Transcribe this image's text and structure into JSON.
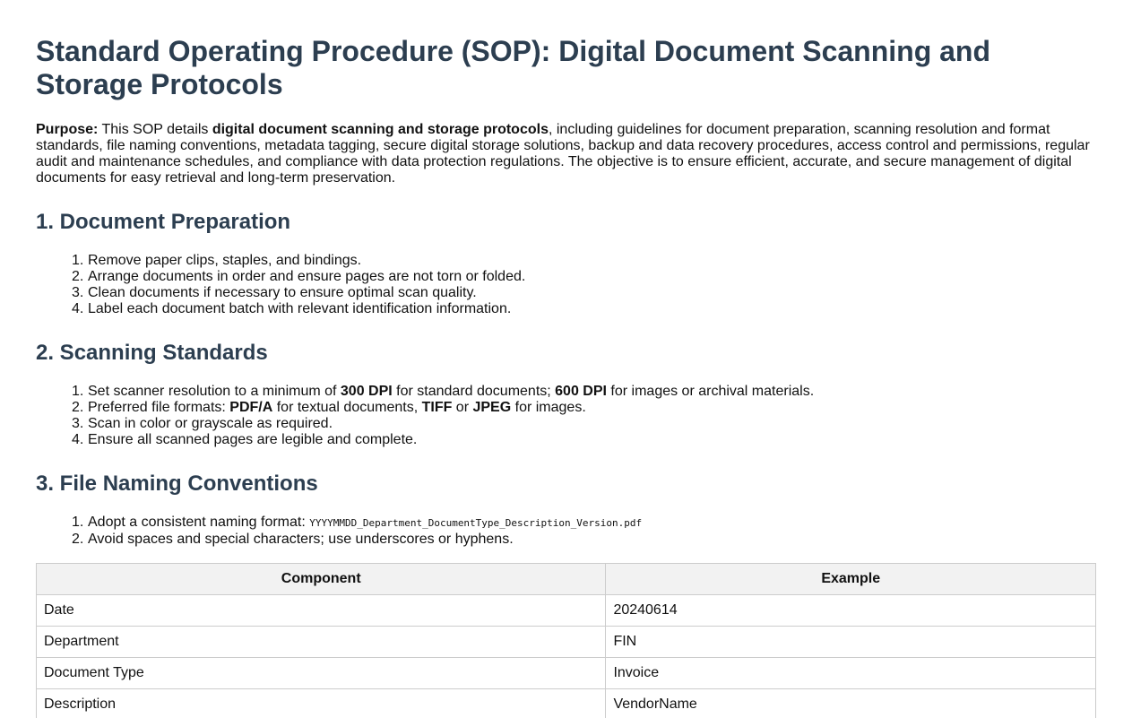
{
  "title": "Standard Operating Procedure (SOP): Digital Document Scanning and Storage Protocols",
  "purpose": {
    "label": "Purpose:",
    "pre": " This SOP details ",
    "bold": "digital document scanning and storage protocols",
    "post": ", including guidelines for document preparation, scanning resolution and format standards, file naming conventions, metadata tagging, secure digital storage solutions, backup and data recovery procedures, access control and permissions, regular audit and maintenance schedules, and compliance with data protection regulations. The objective is to ensure efficient, accurate, and secure management of digital documents for easy retrieval and long-term preservation."
  },
  "sections": [
    {
      "heading": "1. Document Preparation",
      "items": [
        "Remove paper clips, staples, and bindings.",
        "Arrange documents in order and ensure pages are not torn or folded.",
        "Clean documents if necessary to ensure optimal scan quality.",
        "Label each document batch with relevant identification information."
      ]
    },
    {
      "heading": "2. Scanning Standards",
      "items": [
        {
          "t1": "Set scanner resolution to a minimum of ",
          "b1": "300 DPI",
          "t2": " for standard documents; ",
          "b2": "600 DPI",
          "t3": " for images or archival materials."
        },
        {
          "t1": "Preferred file formats: ",
          "b1": "PDF/A",
          "t2": " for textual documents, ",
          "b2": "TIFF",
          "t3": " or ",
          "b3": "JPEG",
          "t4": " for images."
        },
        "Scan in color or grayscale as required.",
        "Ensure all scanned pages are legible and complete."
      ]
    },
    {
      "heading": "3. File Naming Conventions",
      "items": [
        {
          "text": "Adopt a consistent naming format: ",
          "code": "YYYYMMDD_Department_DocumentType_Description_Version.pdf"
        },
        "Avoid spaces and special characters; use underscores or hyphens."
      ]
    }
  ],
  "table": {
    "headers": [
      "Component",
      "Example"
    ],
    "rows": [
      [
        "Date",
        "20240614"
      ],
      [
        "Department",
        "FIN"
      ],
      [
        "Document Type",
        "Invoice"
      ],
      [
        "Description",
        "VendorName"
      ],
      [
        "",
        ""
      ]
    ]
  }
}
